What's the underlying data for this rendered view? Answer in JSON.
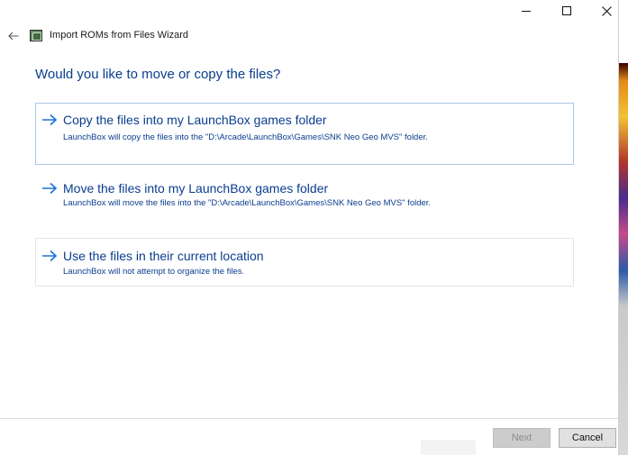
{
  "window": {
    "title": "Import ROMs from Files Wizard",
    "caption_buttons": {
      "minimize": "minimize-icon",
      "maximize": "maximize-icon",
      "close": "close-icon"
    }
  },
  "header": {
    "back_icon": "back-arrow-icon",
    "app_icon": "launchbox-icon"
  },
  "question": "Would you like to move or copy the files?",
  "options": [
    {
      "title": "Copy the files into my LaunchBox games folder",
      "description": "LaunchBox will copy the files into the \"D:\\Arcade\\LaunchBox\\Games\\SNK Neo Geo MVS\" folder.",
      "icon": "arrow-right-icon"
    },
    {
      "title": "Move the files into my LaunchBox games folder",
      "description": "LaunchBox will move the files into the \"D:\\Arcade\\LaunchBox\\Games\\SNK Neo Geo MVS\" folder.",
      "icon": "arrow-right-icon"
    },
    {
      "title": "Use the files in their current location",
      "description": "LaunchBox will not attempt to organize the files.",
      "icon": "arrow-right-icon"
    }
  ],
  "footer": {
    "next_label": "Next",
    "cancel_label": "Cancel"
  },
  "colors": {
    "accent": "#0a3d8f",
    "arrow": "#1a73d9",
    "selected_border": "#a9c8e8"
  }
}
